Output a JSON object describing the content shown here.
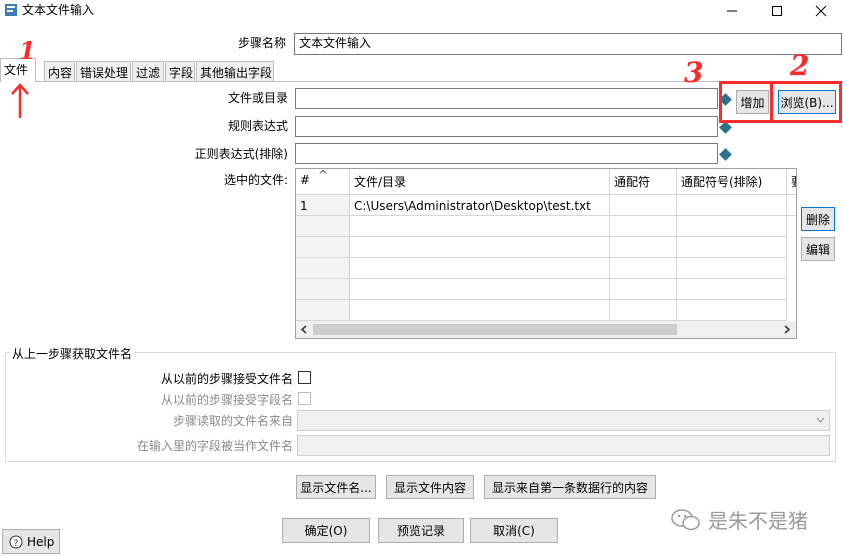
{
  "window": {
    "title": "文本文件输入",
    "minimize": "—",
    "maximize": "☐",
    "close": "✕"
  },
  "step_name": {
    "label": "步骤名称",
    "value": "文本文件输入"
  },
  "tabs": [
    {
      "label": "文件"
    },
    {
      "label": "内容"
    },
    {
      "label": "错误处理"
    },
    {
      "label": "过滤"
    },
    {
      "label": "字段"
    },
    {
      "label": "其他输出字段"
    }
  ],
  "file": {
    "file_or_dir_label": "文件或目录",
    "file_or_dir_value": "",
    "regex_label": "规则表达式",
    "regex_value": "",
    "regex_exclude_label": "正则表达式(排除)",
    "regex_exclude_value": "",
    "add_button": "增加",
    "browse_button": "浏览(B)...",
    "selected_files_label": "选中的文件:",
    "delete_button": "删除",
    "edit_button": "编辑"
  },
  "table": {
    "headers": [
      "#",
      "文件/目录",
      "通配符",
      "通配符号(排除)",
      "要"
    ],
    "sort_indicator": "^",
    "rows": [
      {
        "num": "1",
        "path": "C:\\Users\\Administrator\\Desktop\\test.txt",
        "wildcard": "",
        "wildcard_exclude": ""
      }
    ]
  },
  "prev_step_group": {
    "title": "从上一步骤获取文件名",
    "accept_filenames_label": "从以前的步骤接受文件名",
    "accept_fieldname_label": "从以前的步骤接受字段名",
    "read_filename_from_label": "步骤读取的文件名来自",
    "field_as_filename_label": "在输入里的字段被当作文件名"
  },
  "bottom_buttons": {
    "show_filename": "显示文件名...",
    "show_file_content": "显示文件内容",
    "show_first_row_content": "显示来自第一条数据行的内容"
  },
  "footer": {
    "ok": "确定(O)",
    "preview": "预览记录",
    "cancel": "取消(C)",
    "help": "Help",
    "watermark": "是朱不是猪"
  },
  "annotations": {
    "num1": "1",
    "num2": "2",
    "num3": "3"
  },
  "colors": {
    "accent": "#0078d7",
    "annotation_red": "#ff2a2a"
  }
}
